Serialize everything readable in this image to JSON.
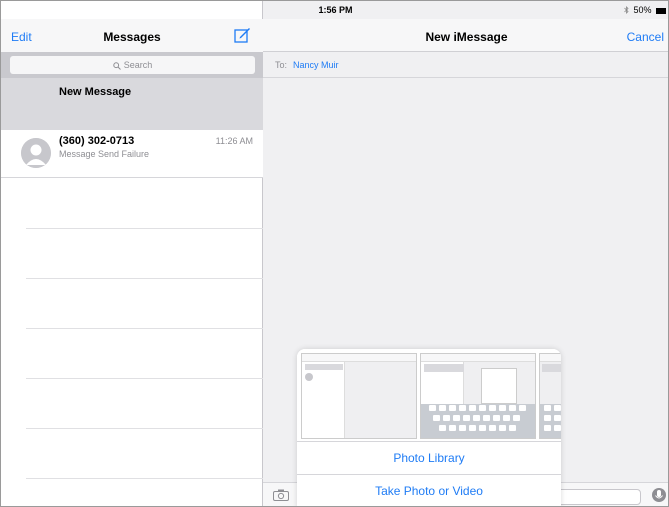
{
  "status_bar": {
    "device": "iPad",
    "time": "1:56 PM",
    "battery": "50%"
  },
  "left_nav": {
    "edit_label": "Edit",
    "title": "Messages"
  },
  "search": {
    "placeholder": "Search"
  },
  "new_message_row": {
    "label": "New Message"
  },
  "conversations": [
    {
      "name": "(360) 302-0713",
      "time": "11:26 AM",
      "preview": "Message Send Failure"
    }
  ],
  "right_nav": {
    "title": "New iMessage",
    "cancel_label": "Cancel"
  },
  "to_field": {
    "label": "To:",
    "recipient": "Nancy Muir"
  },
  "photo_popover": {
    "photo_library_label": "Photo Library",
    "take_photo_label": "Take Photo or Video"
  },
  "colors": {
    "accent": "#1f7cf5",
    "selected_row": "#d9d9dd",
    "background": "#f0f0f2"
  }
}
